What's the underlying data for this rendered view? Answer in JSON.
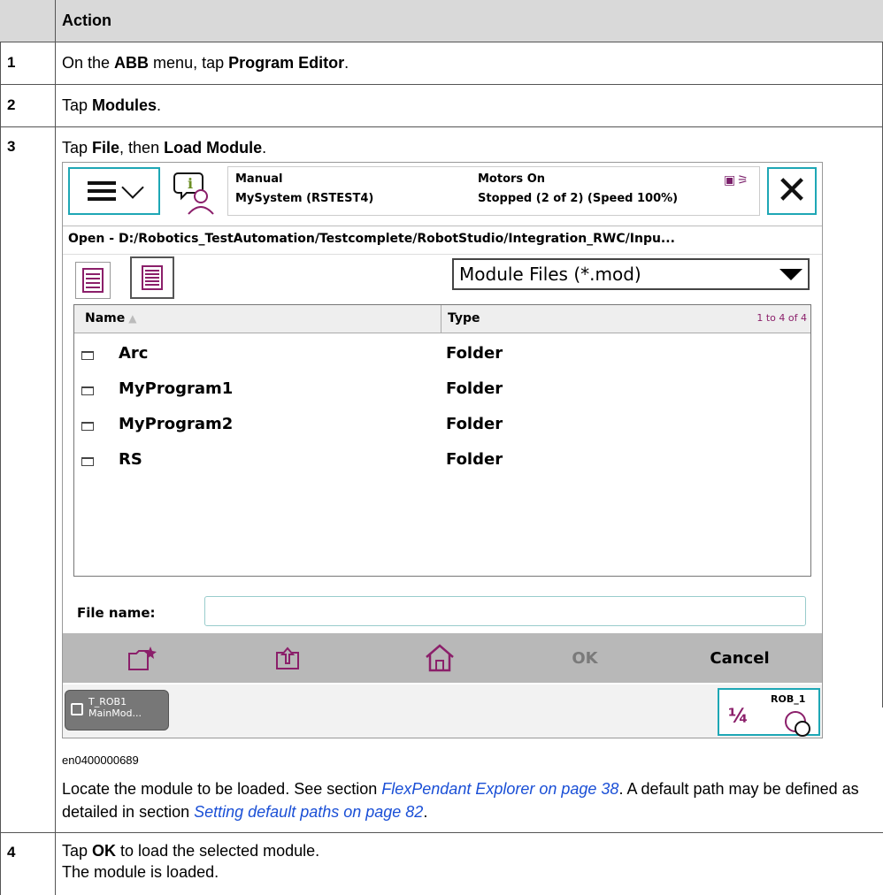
{
  "table": {
    "header": "Action",
    "steps": [
      {
        "num": "1",
        "parts": [
          "On the ",
          "ABB",
          " menu, tap ",
          "Program Editor",
          "."
        ]
      },
      {
        "num": "2",
        "parts": [
          "Tap ",
          "Modules",
          "."
        ]
      },
      {
        "num": "3",
        "parts": [
          "Tap ",
          "File",
          ", then ",
          "Load Module",
          "."
        ]
      },
      {
        "num": "4",
        "line1": [
          "Tap ",
          "OK",
          " to load the selected module."
        ],
        "line2": "The module is loaded."
      }
    ],
    "figure_caption": "en0400000689",
    "step3_note": {
      "t1": "Locate the module to be loaded. See section ",
      "link1": "FlexPendant Explorer on page 38",
      "t2": ". A default path may be defined as detailed in section ",
      "link2": "Setting default paths on page 82",
      "t3": "."
    }
  },
  "pendant": {
    "status": {
      "mode": "Manual",
      "system": "MySystem (RSTEST4)",
      "motors": "Motors On",
      "state": "Stopped (2 of 2) (Speed 100%)"
    },
    "close_label": "✕",
    "path": "Open  -  D:/Robotics_TestAutomation/Testcomplete/RobotStudio/Integration_RWC/Inpu...",
    "filter": "Module Files (*.mod)",
    "columns": {
      "name": "Name",
      "type": "Type",
      "count": "1 to 4 of 4"
    },
    "items": [
      {
        "name": "Arc",
        "type": "Folder"
      },
      {
        "name": "MyProgram1",
        "type": "Folder"
      },
      {
        "name": "MyProgram2",
        "type": "Folder"
      },
      {
        "name": "RS",
        "type": "Folder"
      }
    ],
    "file_name_label": "File name:",
    "file_name_value": "",
    "ok_label": "OK",
    "cancel_label": "Cancel",
    "task": {
      "line1": "T_ROB1",
      "line2": "MainMod..."
    },
    "rob": {
      "label": "ROB_1",
      "frac": "¼"
    },
    "accent": "#1ea7b5",
    "brand": "#8b1f6a"
  }
}
